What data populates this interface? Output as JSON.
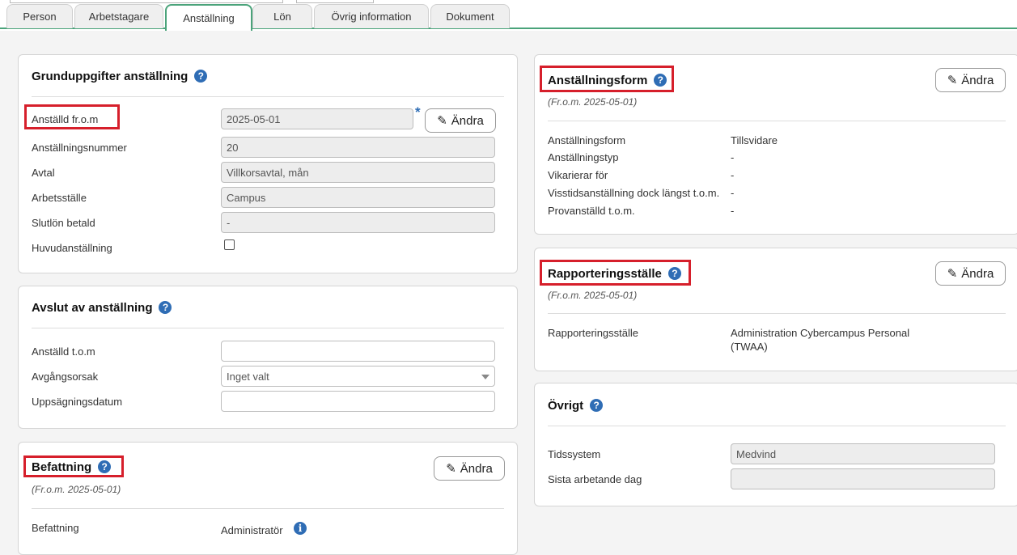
{
  "tabs": [
    {
      "label": "Person"
    },
    {
      "label": "Arbetstagare"
    },
    {
      "label": "Anställning"
    },
    {
      "label": "Lön"
    },
    {
      "label": "Övrig information"
    },
    {
      "label": "Dokument"
    }
  ],
  "active_tab": "Anställning",
  "grunduppgifter": {
    "title": "Grunduppgifter anställning",
    "fields": [
      {
        "label": "Anställd fr.o.m",
        "value": "2025-05-01",
        "required_mark": "*"
      },
      {
        "label": "Anställningsnummer",
        "value": "20"
      },
      {
        "label": "Avtal",
        "value": "Villkorsavtal, mån"
      },
      {
        "label": "Arbetsställe",
        "value": "Campus"
      },
      {
        "label": "Slutlön betald",
        "value": "-"
      }
    ],
    "checkbox_label": "Huvudanställning",
    "checkbox_checked": false,
    "edit_button": "Ändra"
  },
  "avslut": {
    "title": "Avslut av anställning",
    "fields": [
      {
        "label": "Anställd t.o.m",
        "value": ""
      },
      {
        "label": "Avgångsorsak",
        "value": "Inget valt"
      },
      {
        "label": "Uppsägningsdatum",
        "value": ""
      }
    ]
  },
  "befattning": {
    "title": "Befattning",
    "from_text": "(Fr.o.m. 2025-05-01)",
    "edit_button": "Ändra",
    "rows": [
      {
        "label": "Befattning",
        "value": "Administratör"
      }
    ]
  },
  "anstallningsform": {
    "title": "Anställningsform",
    "from_text": "(Fr.o.m. 2025-05-01)",
    "edit_button": "Ändra",
    "rows": [
      {
        "label": "Anställningsform",
        "value": "Tillsvidare"
      },
      {
        "label": "Anställningstyp",
        "value": "-"
      },
      {
        "label": "Vikarierar för",
        "value": "-"
      },
      {
        "label": "Visstidsanställning dock längst t.o.m.",
        "value": "-"
      },
      {
        "label": "Provanställd t.o.m.",
        "value": "-"
      }
    ]
  },
  "rapporteringsstalle": {
    "title": "Rapporteringsställe",
    "from_text": "(Fr.o.m. 2025-05-01)",
    "edit_button": "Ändra",
    "rows": [
      {
        "label": "Rapporteringsställe",
        "value_line1": "Administration Cybercampus Personal",
        "value_line2": "(TWAA)"
      }
    ]
  },
  "ovrigt": {
    "title": "Övrigt",
    "fields": [
      {
        "label": "Tidssystem",
        "value": "Medvind"
      },
      {
        "label": "Sista arbetande dag",
        "value": ""
      }
    ]
  },
  "icons": {
    "help": "?",
    "info": "i",
    "pencil": "✎"
  },
  "colors": {
    "accent_green": "#4aa37a",
    "help_blue": "#2f6db5",
    "highlight_red": "#d61f2b"
  }
}
